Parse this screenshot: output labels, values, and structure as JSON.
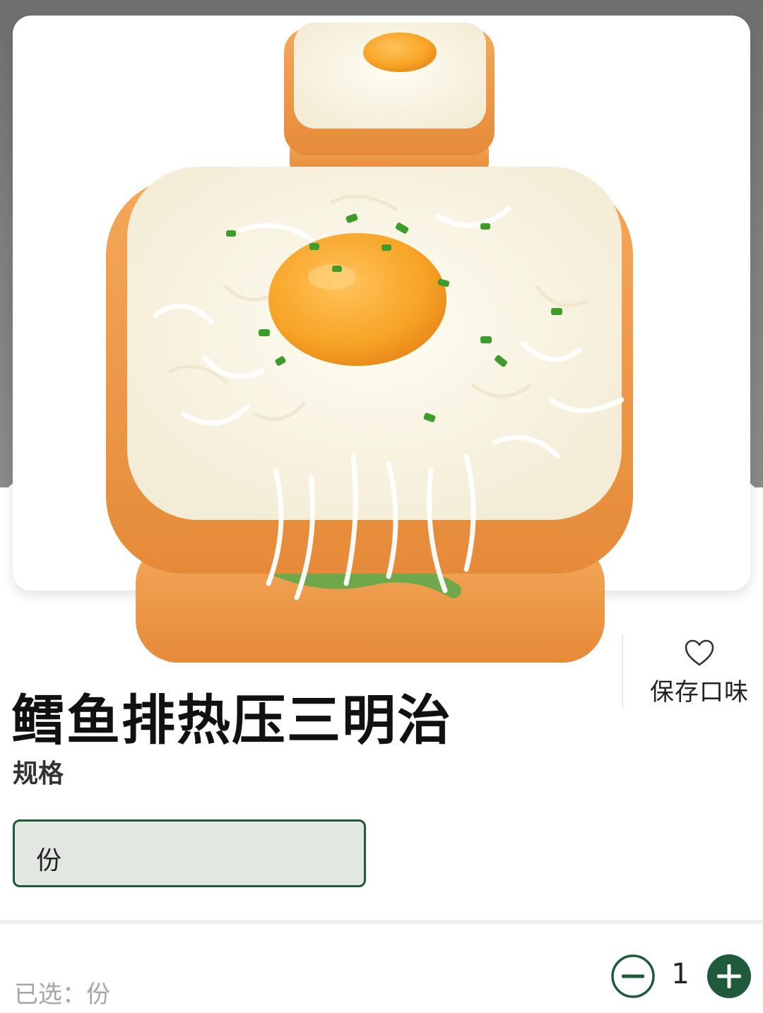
{
  "product": {
    "title": "鳕鱼排热压三明治",
    "save_flavor_label": "保存口味"
  },
  "spec": {
    "label": "规格",
    "options": [
      {
        "label": "份",
        "selected": true
      }
    ]
  },
  "footer": {
    "selected_summary": "已选：份",
    "quantity": "1"
  },
  "icons": {
    "save": "heart-outline-icon",
    "decrease": "minus-circle-icon",
    "increase": "plus-circle-icon"
  },
  "colors": {
    "accent": "#1f5a3c",
    "chip_bg": "#e2e8e1",
    "title": "#111111",
    "muted": "#a6a6a6"
  }
}
